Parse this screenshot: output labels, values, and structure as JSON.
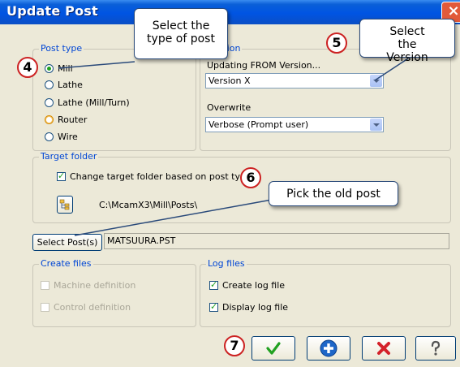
{
  "window": {
    "title": "Update Post"
  },
  "post_type": {
    "label": "Post type",
    "options": [
      {
        "label": "Mill",
        "selected": true
      },
      {
        "label": "Lathe",
        "selected": false
      },
      {
        "label": "Lathe (Mill/Turn)",
        "selected": false
      },
      {
        "label": "Router",
        "selected": false
      },
      {
        "label": "Wire",
        "selected": false
      }
    ]
  },
  "version_group": {
    "label": "Version",
    "from_label": "Updating FROM Version...",
    "from_value": "Version X",
    "overwrite_label": "Overwrite",
    "overwrite_value": "Verbose (Prompt user)"
  },
  "target_folder": {
    "label": "Target folder",
    "checkbox_label": "Change target folder based on post type",
    "checked": true,
    "path": "C:\\McamX3\\Mill\\Posts\\"
  },
  "select_posts": {
    "button_label": "Select Post(s)",
    "value": "MATSUURA.PST"
  },
  "create_files": {
    "label": "Create files",
    "items": [
      {
        "label": "Machine definition",
        "checked": false,
        "enabled": false
      },
      {
        "label": "Control definition",
        "checked": false,
        "enabled": false
      }
    ]
  },
  "log_files": {
    "label": "Log files",
    "items": [
      {
        "label": "Create log file",
        "checked": true
      },
      {
        "label": "Display log file",
        "checked": true
      }
    ]
  },
  "callouts": {
    "type_of_post": "Select the type of post",
    "version": "Select the Version",
    "old_post": "Pick the old post"
  },
  "badges": {
    "b4": "4",
    "b5": "5",
    "b6": "6",
    "b7": "7"
  },
  "buttons": {
    "ok_icon": "check-icon",
    "add_icon": "plus-icon",
    "cancel_icon": "x-icon",
    "help_icon": "question-icon"
  },
  "colors": {
    "title_bar": "#0054e3",
    "group_label": "#0046d5",
    "badge_border": "#cc2222",
    "check_green": "#21a121",
    "cancel_red": "#d4222a"
  }
}
